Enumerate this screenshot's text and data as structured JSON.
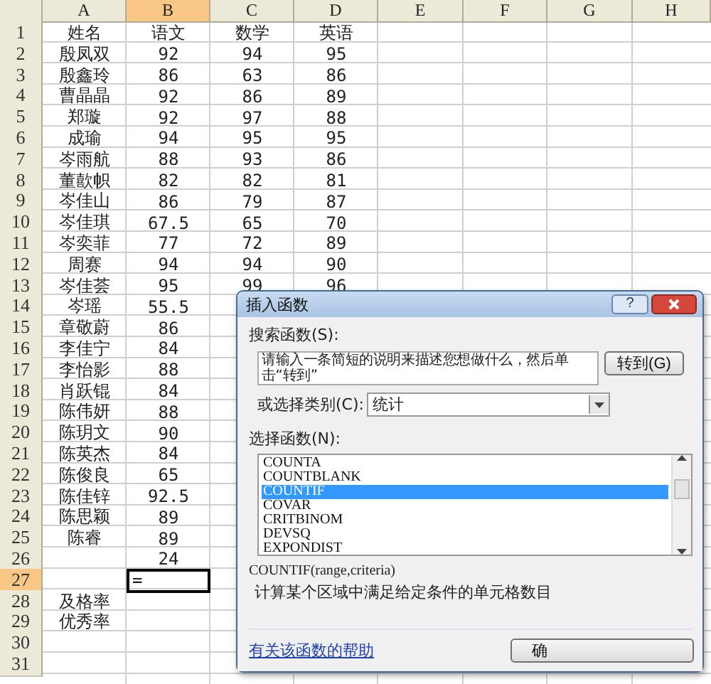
{
  "sheet": {
    "columns": [
      {
        "label": "A",
        "selected": false
      },
      {
        "label": "B",
        "selected": true
      },
      {
        "label": "C",
        "selected": false
      },
      {
        "label": "D",
        "selected": false
      },
      {
        "label": "E",
        "selected": false
      },
      {
        "label": "F",
        "selected": false
      },
      {
        "label": "G",
        "selected": false
      },
      {
        "label": "H",
        "selected": false
      }
    ],
    "rows": [
      {
        "number": "1",
        "selected": false,
        "a": "姓名",
        "b": "语文",
        "c": "数学",
        "d": "英语"
      },
      {
        "number": "2",
        "selected": false,
        "a": "殷凤双",
        "b": "92",
        "c": "94",
        "d": "95"
      },
      {
        "number": "3",
        "selected": false,
        "a": "殷鑫玲",
        "b": "86",
        "c": "63",
        "d": "86"
      },
      {
        "number": "4",
        "selected": false,
        "a": "曹晶晶",
        "b": "92",
        "c": "86",
        "d": "89"
      },
      {
        "number": "5",
        "selected": false,
        "a": "郑璇",
        "b": "92",
        "c": "97",
        "d": "88"
      },
      {
        "number": "6",
        "selected": false,
        "a": "成瑜",
        "b": "94",
        "c": "95",
        "d": "95"
      },
      {
        "number": "7",
        "selected": false,
        "a": "岑雨航",
        "b": "88",
        "c": "93",
        "d": "86"
      },
      {
        "number": "8",
        "selected": false,
        "a": "董歖帜",
        "b": "82",
        "c": "82",
        "d": "81"
      },
      {
        "number": "9",
        "selected": false,
        "a": "岑佳山",
        "b": "86",
        "c": "79",
        "d": "87"
      },
      {
        "number": "10",
        "selected": false,
        "a": "岑佳琪",
        "b": "67.5",
        "c": "65",
        "d": "70"
      },
      {
        "number": "11",
        "selected": false,
        "a": "岑奕菲",
        "b": "77",
        "c": "72",
        "d": "89"
      },
      {
        "number": "12",
        "selected": false,
        "a": "周赛",
        "b": "94",
        "c": "94",
        "d": "90"
      },
      {
        "number": "13",
        "selected": false,
        "a": "岑佳荟",
        "b": "95",
        "c": "99",
        "d": "96"
      },
      {
        "number": "14",
        "selected": false,
        "a": "岑瑶",
        "b": "55.5"
      },
      {
        "number": "15",
        "selected": false,
        "a": "章敬蔚",
        "b": "86"
      },
      {
        "number": "16",
        "selected": false,
        "a": "李佳宁",
        "b": "84"
      },
      {
        "number": "17",
        "selected": false,
        "a": "李怡影",
        "b": "88"
      },
      {
        "number": "18",
        "selected": false,
        "a": "肖跃锟",
        "b": "84"
      },
      {
        "number": "19",
        "selected": false,
        "a": "陈伟妍",
        "b": "88"
      },
      {
        "number": "20",
        "selected": false,
        "a": "陈玥文",
        "b": "90"
      },
      {
        "number": "21",
        "selected": false,
        "a": "陈英杰",
        "b": "84"
      },
      {
        "number": "22",
        "selected": false,
        "a": "陈俊良",
        "b": "65"
      },
      {
        "number": "23",
        "selected": false,
        "a": "陈佳锌",
        "b": "92.5"
      },
      {
        "number": "24",
        "selected": false,
        "a": "陈思颖",
        "b": "89"
      },
      {
        "number": "25",
        "selected": false,
        "a": "陈睿",
        "b": "89"
      },
      {
        "number": "26",
        "selected": false,
        "b": "24"
      },
      {
        "number": "27",
        "selected": true,
        "b": "="
      },
      {
        "number": "28",
        "selected": false,
        "a": "及格率"
      },
      {
        "number": "29",
        "selected": false,
        "a": "优秀率"
      },
      {
        "number": "30",
        "selected": false
      },
      {
        "number": "31",
        "selected": false
      }
    ]
  },
  "dialog": {
    "title": "插入函数",
    "help_button": "?",
    "search_label": "搜索函数(S):",
    "search_text": "请输入一条简短的说明来描述您想做什么，然后单击“转到”",
    "go_button": "转到(G)",
    "category_label": "或选择类别(C):",
    "category_value": "统计",
    "function_label": "选择函数(N):",
    "functions": [
      {
        "name": "COUNTA",
        "selected": false
      },
      {
        "name": "COUNTBLANK",
        "selected": false
      },
      {
        "name": "COUNTIF",
        "selected": true
      },
      {
        "name": "COVAR",
        "selected": false
      },
      {
        "name": "CRITBINOM",
        "selected": false
      },
      {
        "name": "DEVSQ",
        "selected": false
      },
      {
        "name": "EXPONDIST",
        "selected": false
      }
    ],
    "signature": "COUNTIF(range,criteria)",
    "description": "计算某个区域中满足给定条件的单元格数目",
    "help_link": "有关该函数的帮助",
    "ok_button": "确"
  }
}
